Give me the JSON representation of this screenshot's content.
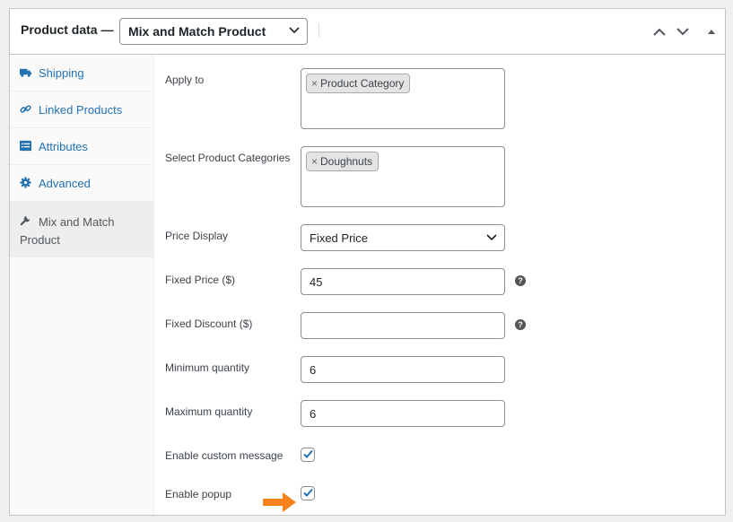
{
  "header": {
    "title": "Product data —",
    "product_type": "Mix and Match Product"
  },
  "sidebar": {
    "items": [
      {
        "label": "Shipping",
        "icon": "truck-icon"
      },
      {
        "label": "Linked Products",
        "icon": "link-icon"
      },
      {
        "label": "Attributes",
        "icon": "list-icon"
      },
      {
        "label": "Advanced",
        "icon": "gear-icon"
      },
      {
        "label": "Mix and Match Product",
        "icon": "wrench-icon"
      }
    ]
  },
  "fields": {
    "apply_to": {
      "label": "Apply to",
      "token": "Product Category",
      "remove": "×"
    },
    "categories": {
      "label": "Select Product Categories",
      "token": "Doughnuts",
      "remove": "×"
    },
    "price_display": {
      "label": "Price Display",
      "value": "Fixed Price"
    },
    "fixed_price": {
      "label": "Fixed Price ($)",
      "value": "45",
      "help": "?"
    },
    "fixed_discount": {
      "label": "Fixed Discount ($)",
      "value": "",
      "help": "?"
    },
    "min_qty": {
      "label": "Minimum quantity",
      "value": "6"
    },
    "max_qty": {
      "label": "Maximum quantity",
      "value": "6"
    },
    "custom_message": {
      "label": "Enable custom message",
      "checked": true
    },
    "popup": {
      "label": "Enable popup",
      "checked": true
    }
  },
  "colors": {
    "accent": "#2271b1",
    "highlight_arrow": "#f7821b",
    "check": "#2271b1"
  }
}
